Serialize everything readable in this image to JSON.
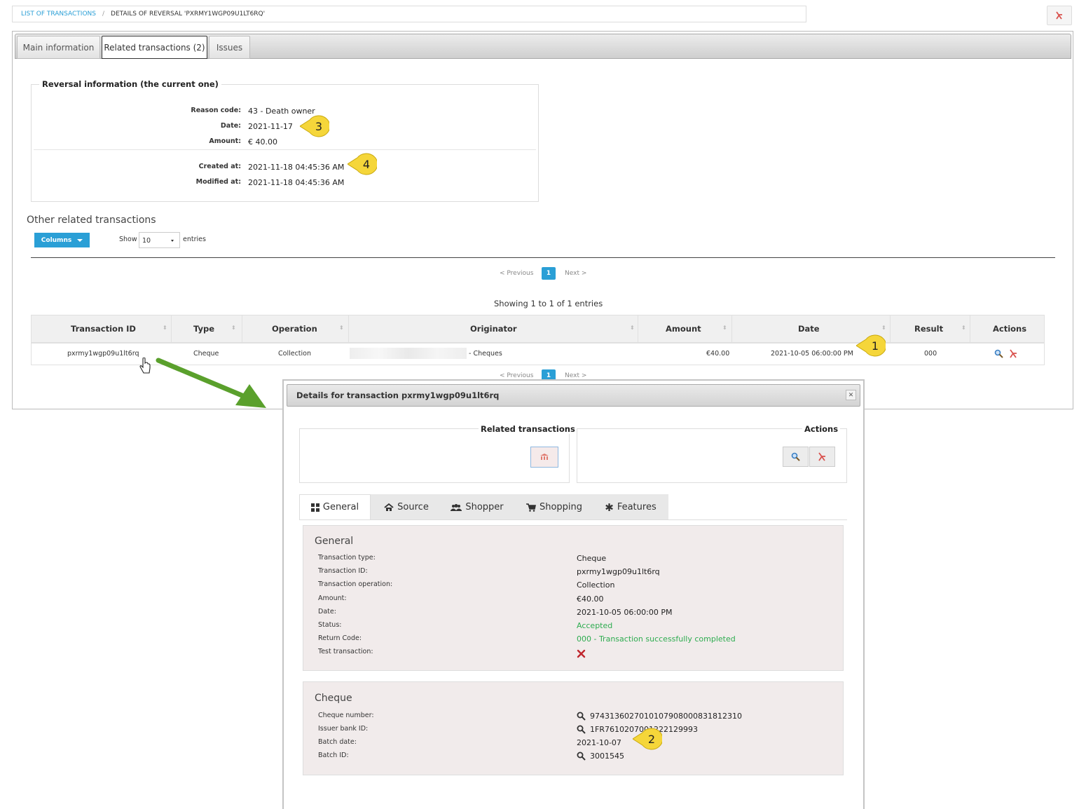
{
  "breadcrumb": {
    "link": "LIST OF TRANSACTIONS",
    "separator": "/",
    "current": "DETAILS OF REVERSAL 'PXRMY1WGP09U1LT6RQ'"
  },
  "tabs": {
    "main": "Main information",
    "related": "Related transactions (2)",
    "issues": "Issues"
  },
  "reversal": {
    "legend": "Reversal information (the current one)",
    "reason_label": "Reason code:",
    "reason_value": "43 - Death owner",
    "date_label": "Date:",
    "date_value": "2021-11-17",
    "amount_label": "Amount:",
    "amount_value": "€ 40.00",
    "created_label": "Created at:",
    "created_value": "2021-11-18 04:45:36 AM",
    "modified_label": "Modified at:",
    "modified_value": "2021-11-18 04:45:36 AM"
  },
  "callouts": {
    "c1": "1",
    "c2": "2",
    "c3": "3",
    "c4": "4"
  },
  "other": {
    "title": "Other related transactions",
    "columns_btn": "Columns",
    "show": "Show",
    "entries_value": "10",
    "entries": "entries",
    "prev": "< Previous",
    "page": "1",
    "next": "Next >",
    "showing": "Showing 1 to 1 of 1 entries"
  },
  "table": {
    "headers": [
      "Transaction ID",
      "Type",
      "Operation",
      "Originator",
      "Amount",
      "Date",
      "Result",
      "Actions"
    ],
    "row": {
      "id": "pxrmy1wgp09u1lt6rq",
      "type": "Cheque",
      "operation": "Collection",
      "originator": "- Cheques",
      "amount": "€40.00",
      "date": "2021-10-05 06:00:00 PM",
      "result": "000"
    }
  },
  "modal": {
    "title": "Details for transaction pxrmy1wgp09u1lt6rq",
    "related_title": "Related transactions",
    "actions_title": "Actions",
    "tabs": [
      "General",
      "Source",
      "Shopper",
      "Shopping",
      "Features"
    ],
    "general": {
      "title": "General",
      "fields": [
        {
          "label": "Transaction type:",
          "value": "Cheque"
        },
        {
          "label": "Transaction ID:",
          "value": "pxrmy1wgp09u1lt6rq"
        },
        {
          "label": "Transaction operation:",
          "value": "Collection"
        },
        {
          "label": "Amount:",
          "value": "€40.00"
        },
        {
          "label": "Date:",
          "value": "2021-10-05 06:00:00 PM"
        },
        {
          "label": "Status:",
          "value": "Accepted"
        },
        {
          "label": "Return Code:",
          "value": "000 - Transaction successfully completed"
        },
        {
          "label": "Test transaction:",
          "value": ""
        }
      ]
    },
    "cheque": {
      "title": "Cheque",
      "fields": [
        {
          "label": "Cheque number:",
          "value": "97431360270101079080008318123​10"
        },
        {
          "label": "Issuer bank ID:",
          "value": "1FR7610207001222129993"
        },
        {
          "label": "Batch date:",
          "value": "2021-10-07"
        },
        {
          "label": "Batch ID:",
          "value": "3001545"
        }
      ]
    }
  },
  "colors": {
    "accent": "#2a9fd6",
    "success": "#2eac50",
    "callout": "#f5d63a",
    "arrow": "#5aa02c"
  }
}
